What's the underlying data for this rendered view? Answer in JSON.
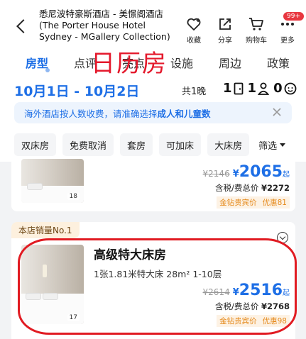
{
  "header": {
    "hotel_name": "悉尼波特豪斯酒店 - 美憬阁酒店 (The Porter House Hotel Sydney - MGallery Collection)",
    "actions": [
      {
        "label": "收藏",
        "icon": "heart-icon"
      },
      {
        "label": "分享",
        "icon": "share-icon"
      },
      {
        "label": "购物车",
        "icon": "cart-icon"
      },
      {
        "label": "更多",
        "icon": "more-icon",
        "badge": "99+"
      }
    ]
  },
  "tabs": [
    "房型",
    "点评",
    "亮点",
    "设施",
    "周边",
    "政策"
  ],
  "overlay_text": "日历房",
  "stay": {
    "dates": "10月1日 - 10月2日",
    "nights": "共1晚",
    "rooms": "1",
    "adults": "1",
    "children": "0"
  },
  "notice": {
    "text": "海外酒店按人数收费，请准确选择",
    "highlight": "成人和儿童数"
  },
  "filters": [
    "双床房",
    "免费取消",
    "套房",
    "可加床",
    "大床房"
  ],
  "filter_more": "筛选",
  "rooms": [
    {
      "orig_price": "¥2146",
      "price_symbol": "¥",
      "price": "2065",
      "suffix": "起",
      "tax_label": "含税/费总价",
      "tax_total": "¥2272",
      "tag_member": "金钻贵宾价",
      "tag_discount": "优惠81",
      "photo_count": "18"
    },
    {
      "badge": "本店销量No.1",
      "name": "高级特大床房",
      "spec": "1张1.81米特大床  28m²  1-10层",
      "orig_price": "¥2614",
      "price_symbol": "¥",
      "price": "2516",
      "suffix": "起",
      "tax_label": "含税/费总价",
      "tax_total": "¥2768",
      "tag_member": "金钻贵宾价",
      "tag_discount": "优惠98",
      "photo_count": "17"
    }
  ],
  "colors": {
    "accent": "#1e6fe6",
    "annotation": "#e11b22",
    "member_tag": "#e5891b"
  }
}
